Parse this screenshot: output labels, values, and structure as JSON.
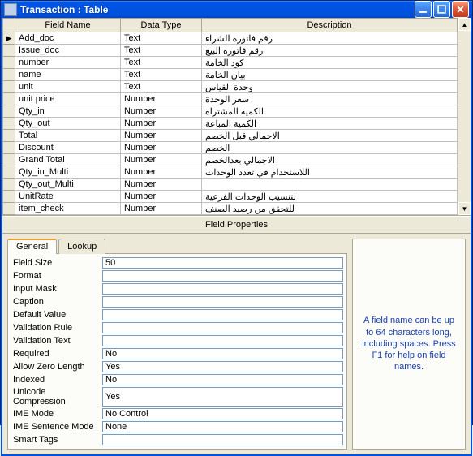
{
  "window": {
    "title": "Transaction : Table"
  },
  "grid": {
    "headers": {
      "field": "Field Name",
      "type": "Data Type",
      "desc": "Description"
    },
    "rows": [
      {
        "sel": true,
        "field": "Add_doc",
        "type": "Text",
        "desc": "رقم فاتورة الشراء"
      },
      {
        "sel": false,
        "field": "Issue_doc",
        "type": "Text",
        "desc": "رقم فاتورة البيع"
      },
      {
        "sel": false,
        "field": "number",
        "type": "Text",
        "desc": "كود الخامة"
      },
      {
        "sel": false,
        "field": "name",
        "type": "Text",
        "desc": "بيان الخامة"
      },
      {
        "sel": false,
        "field": "unit",
        "type": "Text",
        "desc": "وحدة القياس"
      },
      {
        "sel": false,
        "field": "unit price",
        "type": "Number",
        "desc": "سعر الوحدة"
      },
      {
        "sel": false,
        "field": "Qty_in",
        "type": "Number",
        "desc": "الكمية المشتراة"
      },
      {
        "sel": false,
        "field": "Qty_out",
        "type": "Number",
        "desc": "الكمية المباعة"
      },
      {
        "sel": false,
        "field": "Total",
        "type": "Number",
        "desc": "الاجمالي قبل الخصم"
      },
      {
        "sel": false,
        "field": "Discount",
        "type": "Number",
        "desc": "الخصم"
      },
      {
        "sel": false,
        "field": "Grand Total",
        "type": "Number",
        "desc": "الاجمالي بعدالخصم"
      },
      {
        "sel": false,
        "field": "Qty_in_Multi",
        "type": "Number",
        "desc": "اللاستخدام في تعدد الوحدات"
      },
      {
        "sel": false,
        "field": "Qty_out_Multi",
        "type": "Number",
        "desc": ""
      },
      {
        "sel": false,
        "field": "UnitRate",
        "type": "Number",
        "desc": "لتنسيب الوحدات الفرعية"
      },
      {
        "sel": false,
        "field": "item_check",
        "type": "Number",
        "desc": "للتحقق من رصيد الصنف"
      }
    ]
  },
  "sectionLabel": "Field Properties",
  "tabs": {
    "general": "General",
    "lookup": "Lookup"
  },
  "props": [
    {
      "label": "Field Size",
      "value": "50"
    },
    {
      "label": "Format",
      "value": ""
    },
    {
      "label": "Input Mask",
      "value": ""
    },
    {
      "label": "Caption",
      "value": ""
    },
    {
      "label": "Default Value",
      "value": ""
    },
    {
      "label": "Validation Rule",
      "value": ""
    },
    {
      "label": "Validation Text",
      "value": ""
    },
    {
      "label": "Required",
      "value": "No"
    },
    {
      "label": "Allow Zero Length",
      "value": "Yes"
    },
    {
      "label": "Indexed",
      "value": "No"
    },
    {
      "label": "Unicode Compression",
      "value": "Yes"
    },
    {
      "label": "IME Mode",
      "value": "No Control"
    },
    {
      "label": "IME Sentence Mode",
      "value": "None"
    },
    {
      "label": "Smart Tags",
      "value": ""
    }
  ],
  "hint": "A field name can be up to 64 characters long, including spaces. Press F1 for help on field names."
}
